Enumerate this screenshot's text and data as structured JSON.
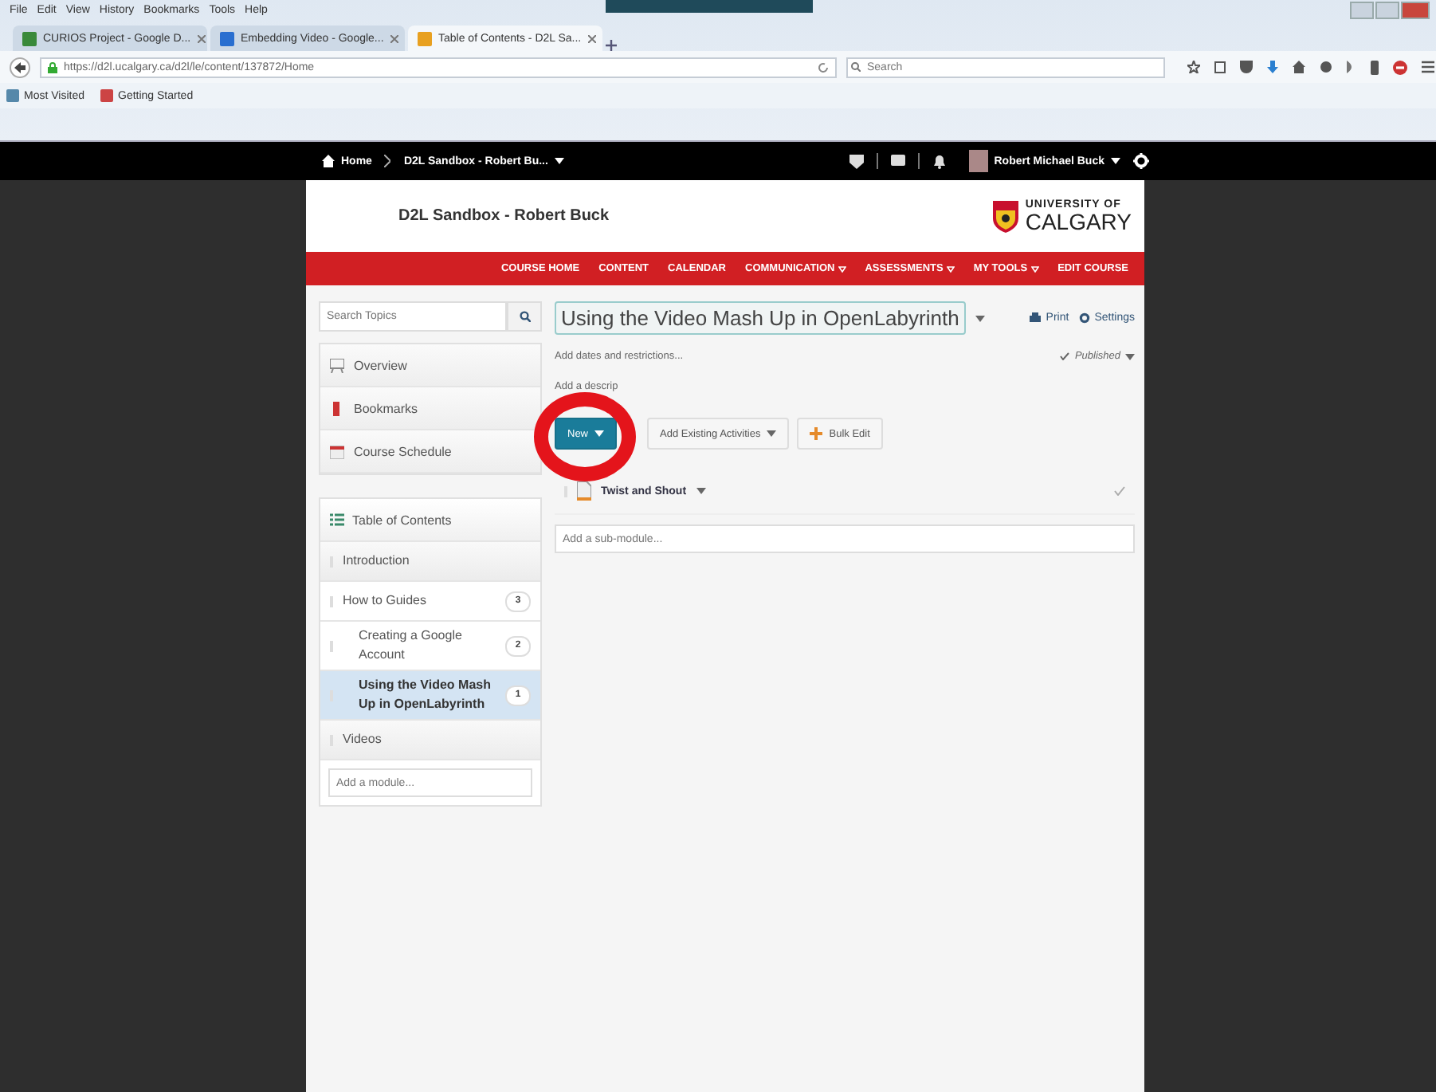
{
  "browser": {
    "menu": [
      "File",
      "Edit",
      "View",
      "History",
      "Bookmarks",
      "Tools",
      "Help"
    ],
    "tabs": [
      {
        "label": "CURIOS Project - Google D...",
        "selected": false
      },
      {
        "label": "Embedding Video - Google...",
        "selected": false
      },
      {
        "label": "Table of Contents - D2L Sa...",
        "selected": true
      }
    ],
    "url": "https://d2l.ucalgary.ca/d2l/le/content/137872/Home",
    "search": {
      "placeholder": "Search"
    },
    "bookmarks": [
      "Most Visited",
      "Getting Started"
    ]
  },
  "topbar": {
    "home": "Home",
    "course": "D2L Sandbox - Robert Bu...",
    "user": "Robert Michael Buck"
  },
  "header": {
    "course_title": "D2L Sandbox - Robert Buck",
    "logo_line1": "UNIVERSITY OF",
    "logo_line2": "CALGARY"
  },
  "nav": [
    {
      "label": "COURSE HOME",
      "has_menu": false
    },
    {
      "label": "CONTENT",
      "has_menu": false
    },
    {
      "label": "CALENDAR",
      "has_menu": false
    },
    {
      "label": "COMMUNICATION",
      "has_menu": true
    },
    {
      "label": "ASSESSMENTS",
      "has_menu": true
    },
    {
      "label": "MY TOOLS",
      "has_menu": true
    },
    {
      "label": "EDIT COURSE",
      "has_menu": false
    }
  ],
  "sidebar": {
    "search": {
      "placeholder": "Search Topics"
    },
    "links": [
      {
        "label": "Overview",
        "kind": "overview"
      },
      {
        "label": "Bookmarks",
        "kind": "bookmark"
      },
      {
        "label": "Course Schedule",
        "kind": "calendar"
      }
    ],
    "toc": "Table of Contents",
    "modules": [
      {
        "label": "Introduction",
        "selected": false
      },
      {
        "label": "How to Guides",
        "count": "3",
        "selected": false,
        "children": [
          {
            "label": "Creating a Google Account",
            "count": "2",
            "selected": false
          },
          {
            "label": "Using the Video Mash Up in OpenLabyrinth",
            "count": "1",
            "selected": true
          }
        ]
      },
      {
        "label": "Videos",
        "selected": false
      }
    ],
    "add_module": {
      "placeholder": "Add a module..."
    }
  },
  "main": {
    "title": "Using the Video Mash Up in OpenLabyrinth",
    "print": "Print",
    "settings": "Settings",
    "dates": "Add dates and restrictions...",
    "status": "Published",
    "description": "Add a descrip",
    "buttons": [
      {
        "label": "New",
        "kind": "primary"
      },
      {
        "label": "Add Existing Activities",
        "kind": "dropdown"
      },
      {
        "label": "Bulk Edit",
        "kind": "bulk"
      }
    ],
    "topics": [
      {
        "title": "Twist and Shout"
      }
    ],
    "add_submodule": {
      "placeholder": "Add a sub-module..."
    }
  },
  "annotation": {
    "kind": "circle"
  }
}
